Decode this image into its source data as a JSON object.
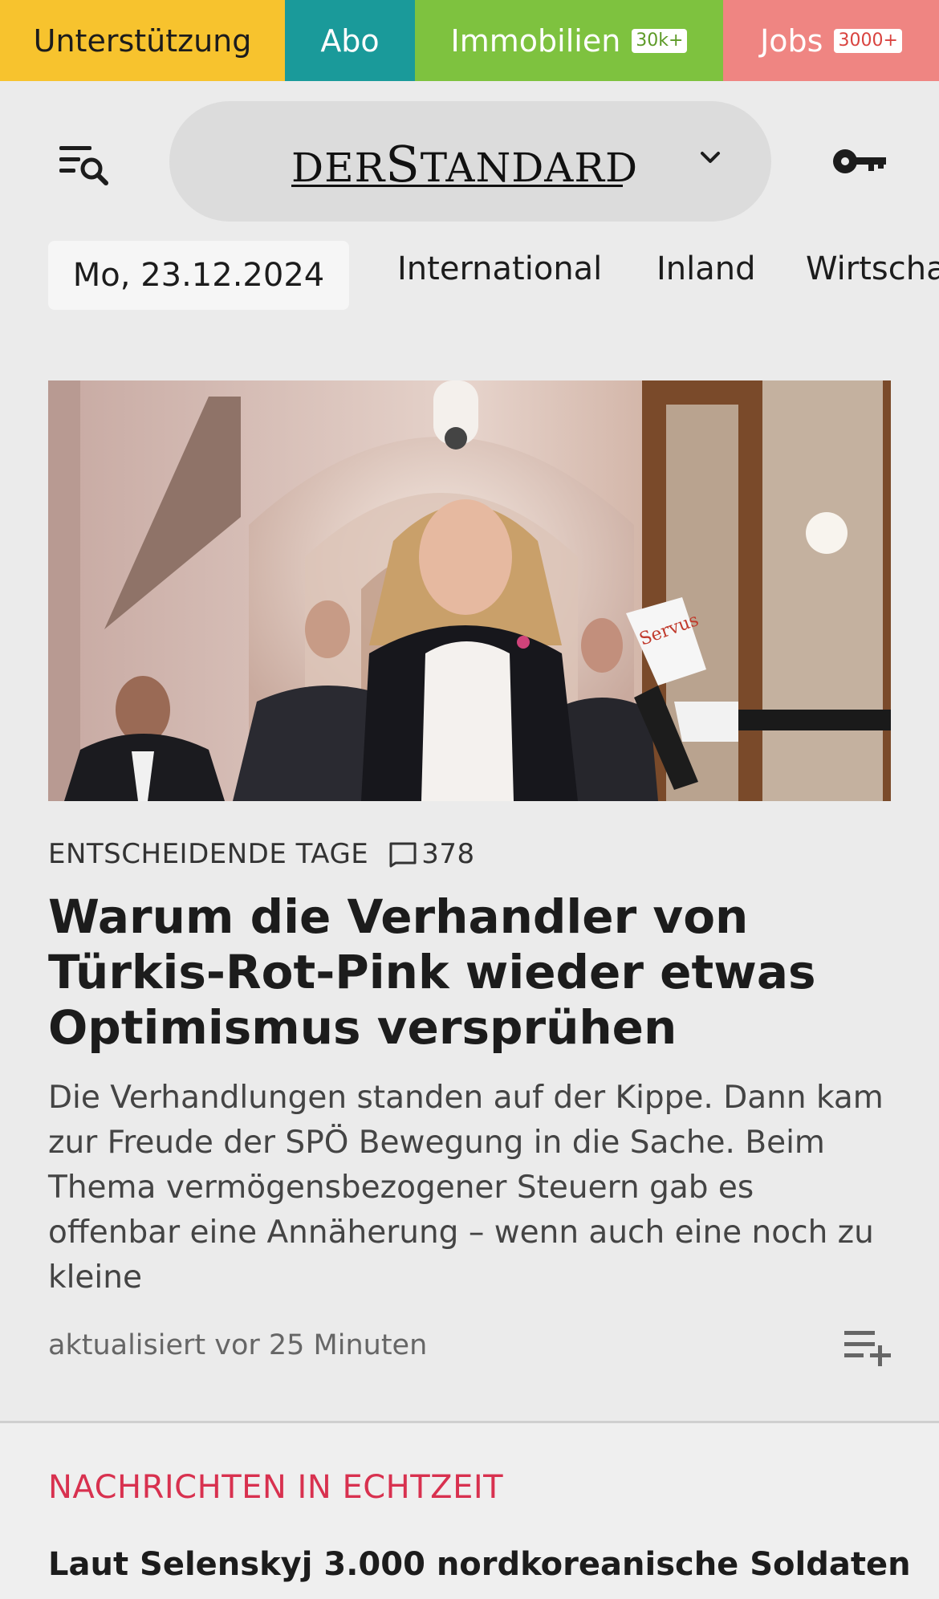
{
  "topbar": {
    "support": "Unterstützung",
    "abo": "Abo",
    "immobilien": "Immobilien",
    "immobilien_badge": "30k+",
    "jobs": "Jobs",
    "jobs_badge": "3000+"
  },
  "header": {
    "logo_part1": "DER",
    "logo_part2": "S",
    "logo_part3": "TANDARD"
  },
  "nav": {
    "date": "Mo, 23.12.2024",
    "items": [
      "International",
      "Inland",
      "Wirtscha"
    ]
  },
  "article": {
    "kicker": "ENTSCHEIDENDE TAGE",
    "comments": "378",
    "headline": "Warum die Verhandler von Türkis-Rot-Pink wieder etwas Optimismus versprühen",
    "teaser": "Die Verhandlungen standen auf der Kippe. Dann kam zur Freude der SPÖ Bewegung in die Sache. Beim Thema vermögensbezogener Steuern gab es offenbar eine Annäherung – wenn auch eine noch zu kleine",
    "updated": "aktualisiert vor 25 Minuten",
    "mic_label": "Servus"
  },
  "live": {
    "heading": "NACHRICHTEN IN ECHTZEIT",
    "first_title": "Laut Selenskyj 3.000 nordkoreanische Soldaten"
  },
  "colors": {
    "support": "#f7c32e",
    "abo": "#1a9a9a",
    "immobilien": "#7ec23f",
    "jobs": "#ef8582",
    "live_accent": "#d8314f"
  },
  "icons": [
    "menu-search-icon",
    "chevron-down-icon",
    "key-icon",
    "comment-icon",
    "playlist-add-icon"
  ]
}
